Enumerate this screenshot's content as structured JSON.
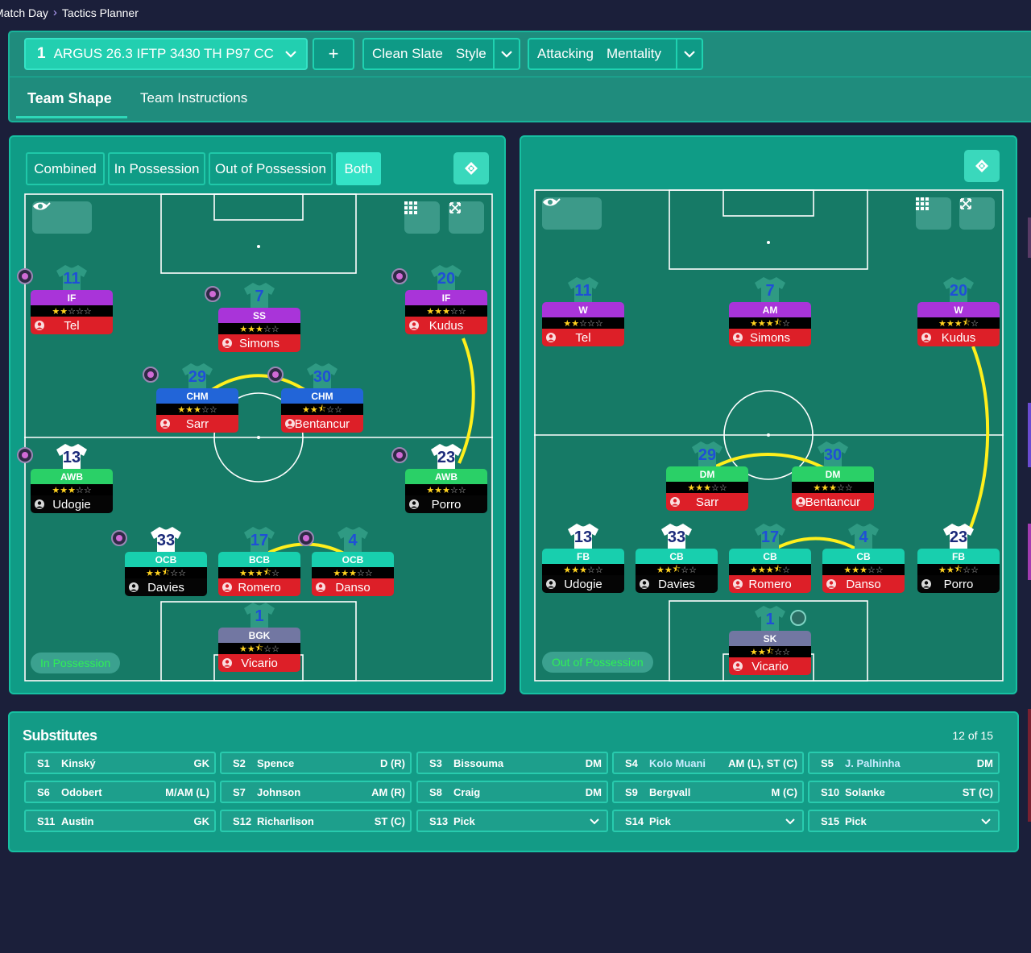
{
  "breadcrumb": {
    "parent": "Match Day",
    "current": "Tactics Planner"
  },
  "top": {
    "tactic_slot": "1",
    "tactic_name": "ARGUS 26.3 IFTP 3430 TH P97 CC",
    "add_label": "+",
    "style_value": "Clean Slate",
    "style_label": "Style",
    "mentality_value": "Attacking",
    "mentality_label": "Mentality",
    "tabs": [
      "Team Shape",
      "Team Instructions"
    ]
  },
  "left_panel": {
    "toggles": [
      "Combined",
      "In Possession",
      "Out of Possession",
      "Both"
    ],
    "active_toggle": "Both",
    "mode_label": "In Possession"
  },
  "right_panel": {
    "mode_label": "Out of Possession"
  },
  "in_possession": [
    {
      "num": "11",
      "pos": "IF",
      "color": "purple",
      "stars": 2,
      "name": "Tel",
      "name_style": "red",
      "badge": true
    },
    {
      "num": "7",
      "pos": "SS",
      "color": "purple",
      "stars": 3,
      "name": "Simons",
      "name_style": "red",
      "badge": true
    },
    {
      "num": "20",
      "pos": "IF",
      "color": "purple",
      "stars": 3,
      "name": "Kudus",
      "name_style": "red",
      "badge": true
    },
    {
      "num": "29",
      "pos": "CHM",
      "color": "blue",
      "stars": 3,
      "name": "Sarr",
      "name_style": "red",
      "badge": true
    },
    {
      "num": "30",
      "pos": "CHM",
      "color": "blue",
      "stars": 2.5,
      "name": "Bentancur",
      "name_style": "red",
      "badge": true
    },
    {
      "num": "13",
      "pos": "AWB",
      "color": "green",
      "stars": 3,
      "name": "Udogie",
      "name_style": "dark",
      "badge": true,
      "white": true
    },
    {
      "num": "23",
      "pos": "AWB",
      "color": "green",
      "stars": 3,
      "name": "Porro",
      "name_style": "dark",
      "badge": true,
      "white": true
    },
    {
      "num": "33",
      "pos": "OCB",
      "color": "teal",
      "stars": 2.5,
      "name": "Davies",
      "name_style": "dark",
      "badge": true,
      "white": true
    },
    {
      "num": "17",
      "pos": "BCB",
      "color": "teal",
      "stars": 3.5,
      "name": "Romero",
      "name_style": "red",
      "badge": false
    },
    {
      "num": "4",
      "pos": "OCB",
      "color": "teal",
      "stars": 3,
      "name": "Danso",
      "name_style": "red",
      "badge": true
    },
    {
      "num": "1",
      "pos": "BGK",
      "color": "grey",
      "stars": 2.5,
      "name": "Vicario",
      "name_style": "red",
      "badge": false
    }
  ],
  "out_of_possession": [
    {
      "num": "11",
      "pos": "W",
      "color": "purple",
      "stars": 2,
      "name": "Tel",
      "name_style": "red"
    },
    {
      "num": "7",
      "pos": "AM",
      "color": "purple",
      "stars": 3.5,
      "name": "Simons",
      "name_style": "red"
    },
    {
      "num": "20",
      "pos": "W",
      "color": "purple",
      "stars": 3.5,
      "name": "Kudus",
      "name_style": "red"
    },
    {
      "num": "29",
      "pos": "DM",
      "color": "green",
      "stars": 3,
      "name": "Sarr",
      "name_style": "red"
    },
    {
      "num": "30",
      "pos": "DM",
      "color": "green",
      "stars": 3,
      "name": "Bentancur",
      "name_style": "red"
    },
    {
      "num": "13",
      "pos": "FB",
      "color": "teal",
      "stars": 3,
      "name": "Udogie",
      "name_style": "dark",
      "white": true
    },
    {
      "num": "33",
      "pos": "CB",
      "color": "teal",
      "stars": 2.5,
      "name": "Davies",
      "name_style": "dark",
      "white": true
    },
    {
      "num": "17",
      "pos": "CB",
      "color": "teal",
      "stars": 3.5,
      "name": "Romero",
      "name_style": "red"
    },
    {
      "num": "4",
      "pos": "CB",
      "color": "teal",
      "stars": 3,
      "name": "Danso",
      "name_style": "red"
    },
    {
      "num": "23",
      "pos": "FB",
      "color": "teal",
      "stars": 2.5,
      "name": "Porro",
      "name_style": "dark",
      "white": true
    },
    {
      "num": "1",
      "pos": "SK",
      "color": "grey",
      "stars": 2.5,
      "name": "Vicario",
      "name_style": "red"
    }
  ],
  "substitutes": {
    "title": "Substitutes",
    "count": "12 of 15",
    "items": [
      {
        "slot": "S1",
        "name": "Kinský",
        "pos": "GK"
      },
      {
        "slot": "S2",
        "name": "Spence",
        "pos": "D (R)"
      },
      {
        "slot": "S3",
        "name": "Bissouma",
        "pos": "DM"
      },
      {
        "slot": "S4",
        "name": "Kolo Muani",
        "pos": "AM (L), ST (C)",
        "highlight": true
      },
      {
        "slot": "S5",
        "name": "J. Palhinha",
        "pos": "DM",
        "highlight": true
      },
      {
        "slot": "S6",
        "name": "Odobert",
        "pos": "M/AM (L)"
      },
      {
        "slot": "S7",
        "name": "Johnson",
        "pos": "AM (R)"
      },
      {
        "slot": "S8",
        "name": "Craig",
        "pos": "DM"
      },
      {
        "slot": "S9",
        "name": "Bergvall",
        "pos": "M (C)"
      },
      {
        "slot": "S10",
        "name": "Solanke",
        "pos": "ST (C)"
      },
      {
        "slot": "S11",
        "name": "Austin",
        "pos": "GK"
      },
      {
        "slot": "S12",
        "name": "Richarlison",
        "pos": "ST (C)"
      },
      {
        "slot": "S13",
        "name": "Pick",
        "pos": "",
        "dropdown": true
      },
      {
        "slot": "S14",
        "name": "Pick",
        "pos": "",
        "dropdown": true
      },
      {
        "slot": "S15",
        "name": "Pick",
        "pos": "",
        "dropdown": true
      }
    ]
  },
  "colors": {
    "background": "#1b1f3a",
    "panel": "#0f9c86",
    "pitch": "#167a66",
    "link_line": "#ffef1c"
  }
}
